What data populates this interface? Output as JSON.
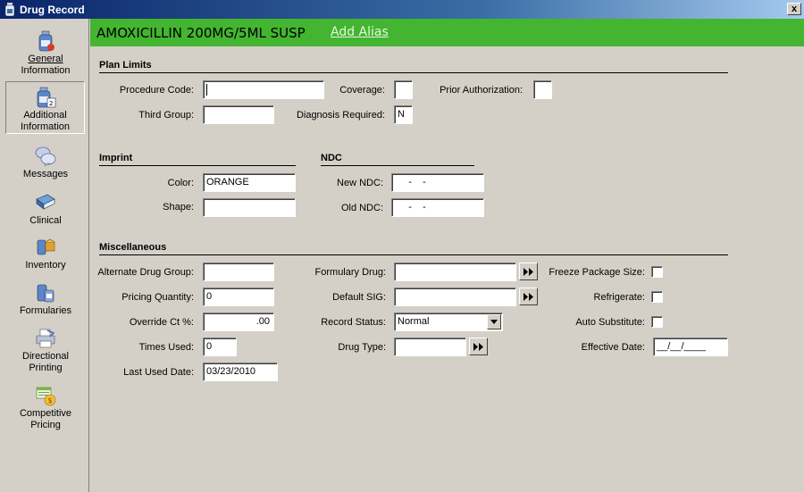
{
  "window": {
    "title": "Drug Record",
    "close_label": "x"
  },
  "sidebar": {
    "items": [
      {
        "label_line1": "General",
        "label_line2": "Information",
        "icon": "bottle-info-icon"
      },
      {
        "label_line1": "Additional",
        "label_line2": "Information",
        "icon": "bottle-2-icon",
        "selected": true
      },
      {
        "label_line1": "Messages",
        "label_line2": "",
        "icon": "messages-icon"
      },
      {
        "label_line1": "Clinical",
        "label_line2": "",
        "icon": "clinical-book-icon"
      },
      {
        "label_line1": "Inventory",
        "label_line2": "",
        "icon": "inventory-icon"
      },
      {
        "label_line1": "Formularies",
        "label_line2": "",
        "icon": "formularies-icon"
      },
      {
        "label_line1": "Directional",
        "label_line2": "Printing",
        "icon": "printer-icon"
      },
      {
        "label_line1": "Competitive",
        "label_line2": "Pricing",
        "icon": "pricing-icon"
      }
    ]
  },
  "header": {
    "drug_name": "AMOXICILLIN 200MG/5ML SUSP",
    "alias_link": "Add Alias",
    "color": "#43b530"
  },
  "plan_limits": {
    "title": "Plan Limits",
    "procedure_code_label": "Procedure Code:",
    "procedure_code_value": "",
    "coverage_label": "Coverage:",
    "coverage_value": "",
    "prior_auth_label": "Prior Authorization:",
    "prior_auth_value": "",
    "third_group_label": "Third Group:",
    "third_group_value": "",
    "diagnosis_label": "Diagnosis Required:",
    "diagnosis_value": "N"
  },
  "imprint": {
    "title": "Imprint",
    "color_label": "Color:",
    "color_value": "ORANGE",
    "shape_label": "Shape:",
    "shape_value": ""
  },
  "ndc": {
    "title": "NDC",
    "new_label": "New NDC:",
    "new_value": "     -    -",
    "old_label": "Old NDC:",
    "old_value": "     -    -"
  },
  "misc": {
    "title": "Miscellaneous",
    "alt_group_label": "Alternate Drug Group:",
    "alt_group_value": "",
    "pricing_qty_label": "Pricing Quantity:",
    "pricing_qty_value": "0",
    "override_label": "Override Ct %:",
    "override_value": ".00",
    "times_used_label": "Times Used:",
    "times_used_value": "0",
    "last_used_label": "Last Used Date:",
    "last_used_value": "03/23/2010",
    "formulary_label": "Formulary Drug:",
    "formulary_value": "",
    "default_sig_label": "Default SIG:",
    "default_sig_value": "",
    "record_status_label": "Record Status:",
    "record_status_value": "Normal",
    "drug_type_label": "Drug Type:",
    "drug_type_value": "",
    "freeze_label": "Freeze Package Size:",
    "refrigerate_label": "Refrigerate:",
    "auto_sub_label": "Auto Substitute:",
    "effective_label": "Effective Date:",
    "effective_value": "__/__/____"
  }
}
